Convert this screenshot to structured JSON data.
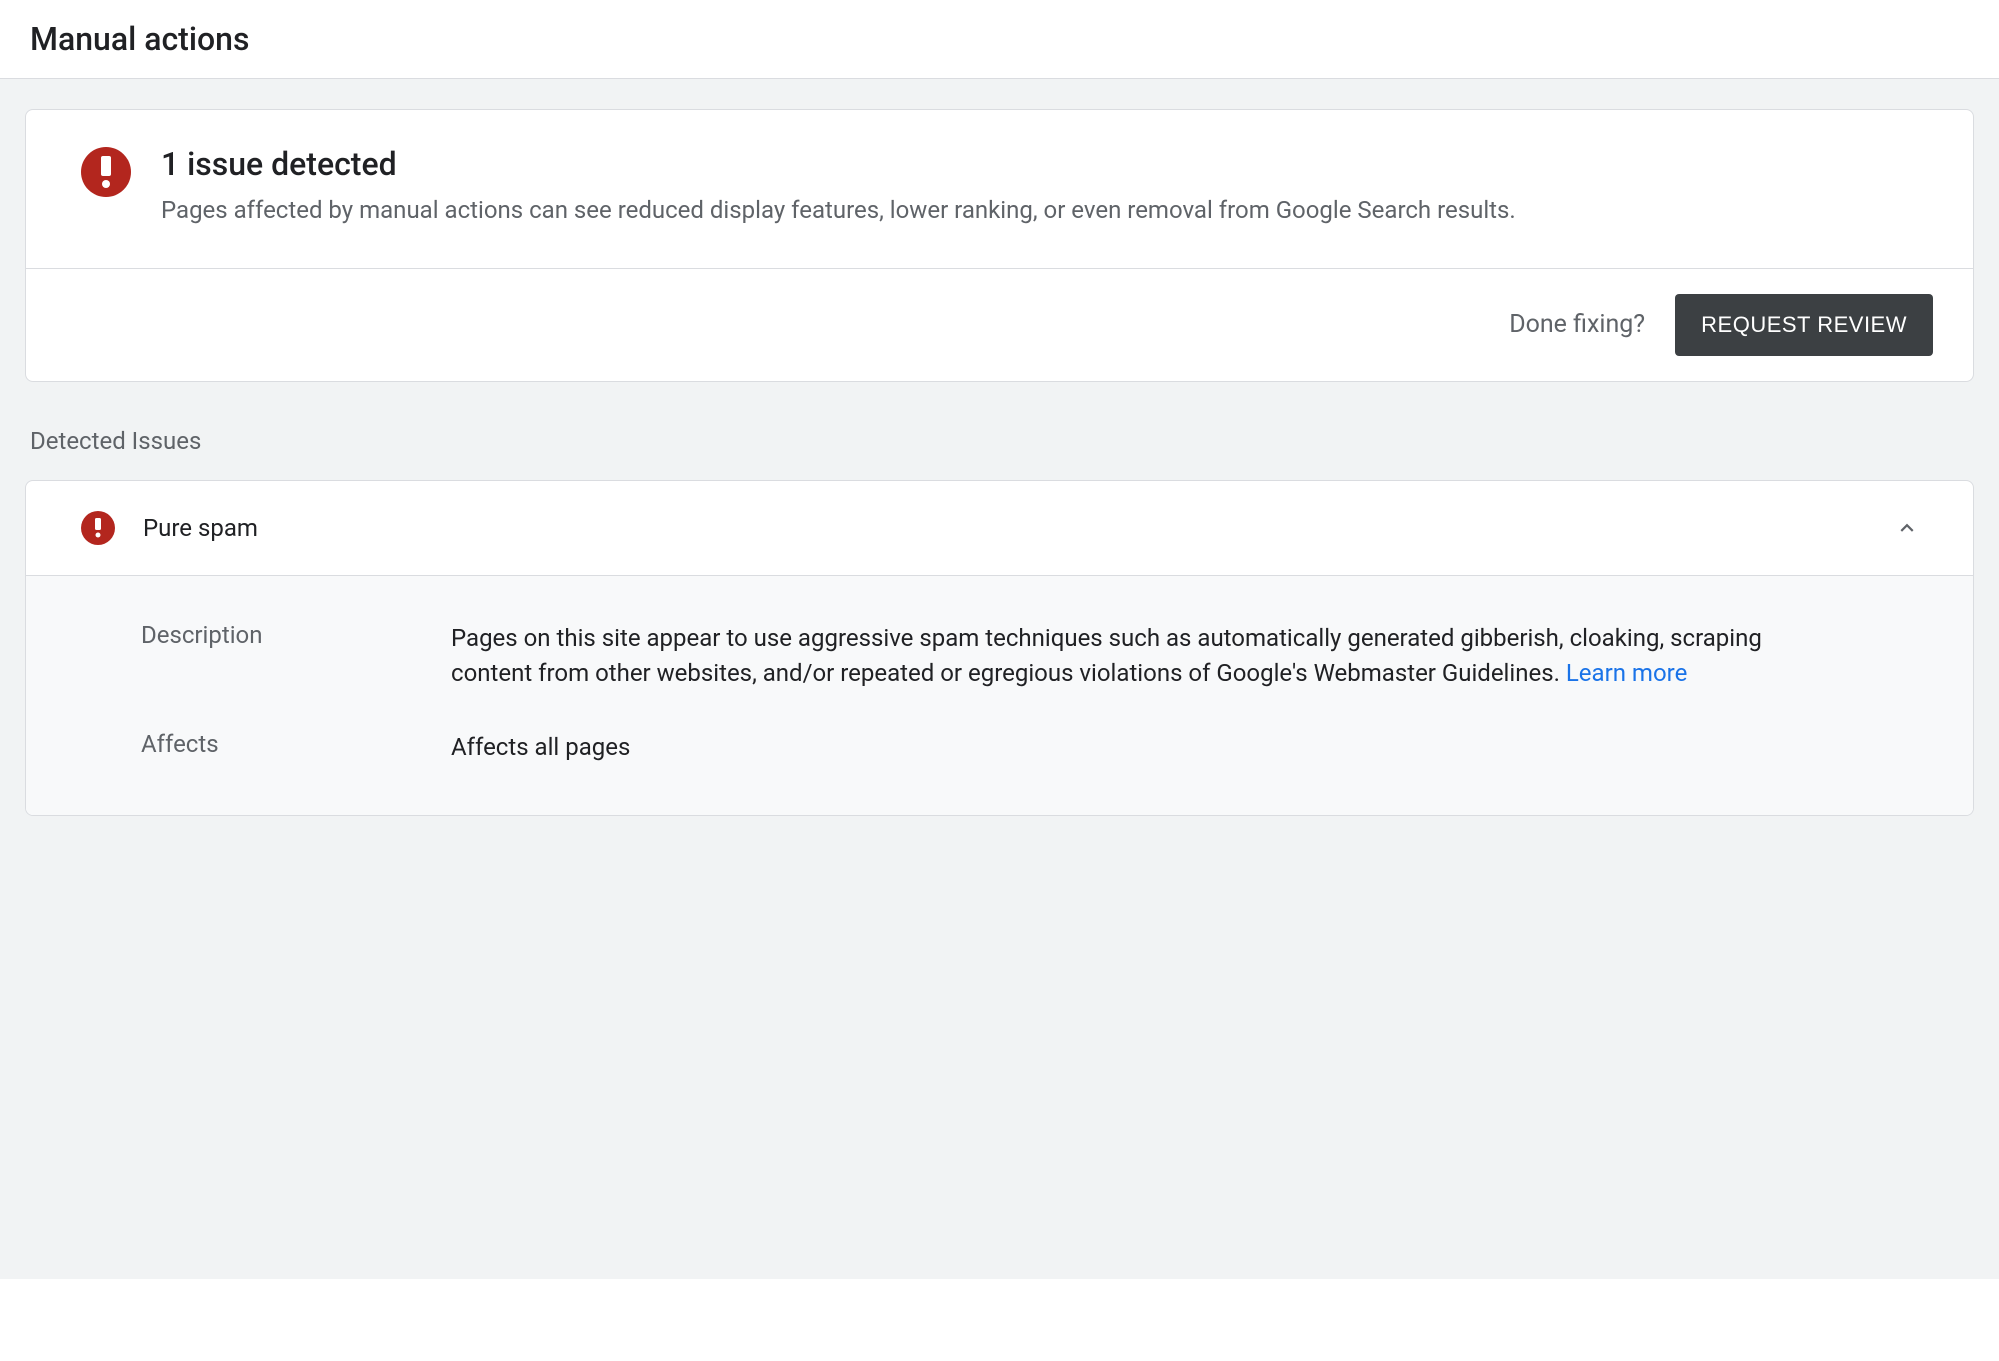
{
  "header": {
    "title": "Manual actions"
  },
  "summary": {
    "title": "1 issue detected",
    "description": "Pages affected by manual actions can see reduced display features, lower ranking, or even removal from Google Search results."
  },
  "action_bar": {
    "prompt": "Done fixing?",
    "button": "REQUEST REVIEW"
  },
  "issues": {
    "section_label": "Detected Issues",
    "items": [
      {
        "title": "Pure spam",
        "description_label": "Description",
        "description_value": "Pages on this site appear to use aggressive spam techniques such as automatically generated gibberish, cloaking, scraping content from other websites, and/or repeated or egregious violations of Google's Webmaster Guidelines. ",
        "learn_more": "Learn more",
        "affects_label": "Affects",
        "affects_value": "Affects all pages"
      }
    ]
  },
  "colors": {
    "alert": "#b3261e",
    "button_bg": "#3c4043",
    "link": "#1a73e8"
  }
}
